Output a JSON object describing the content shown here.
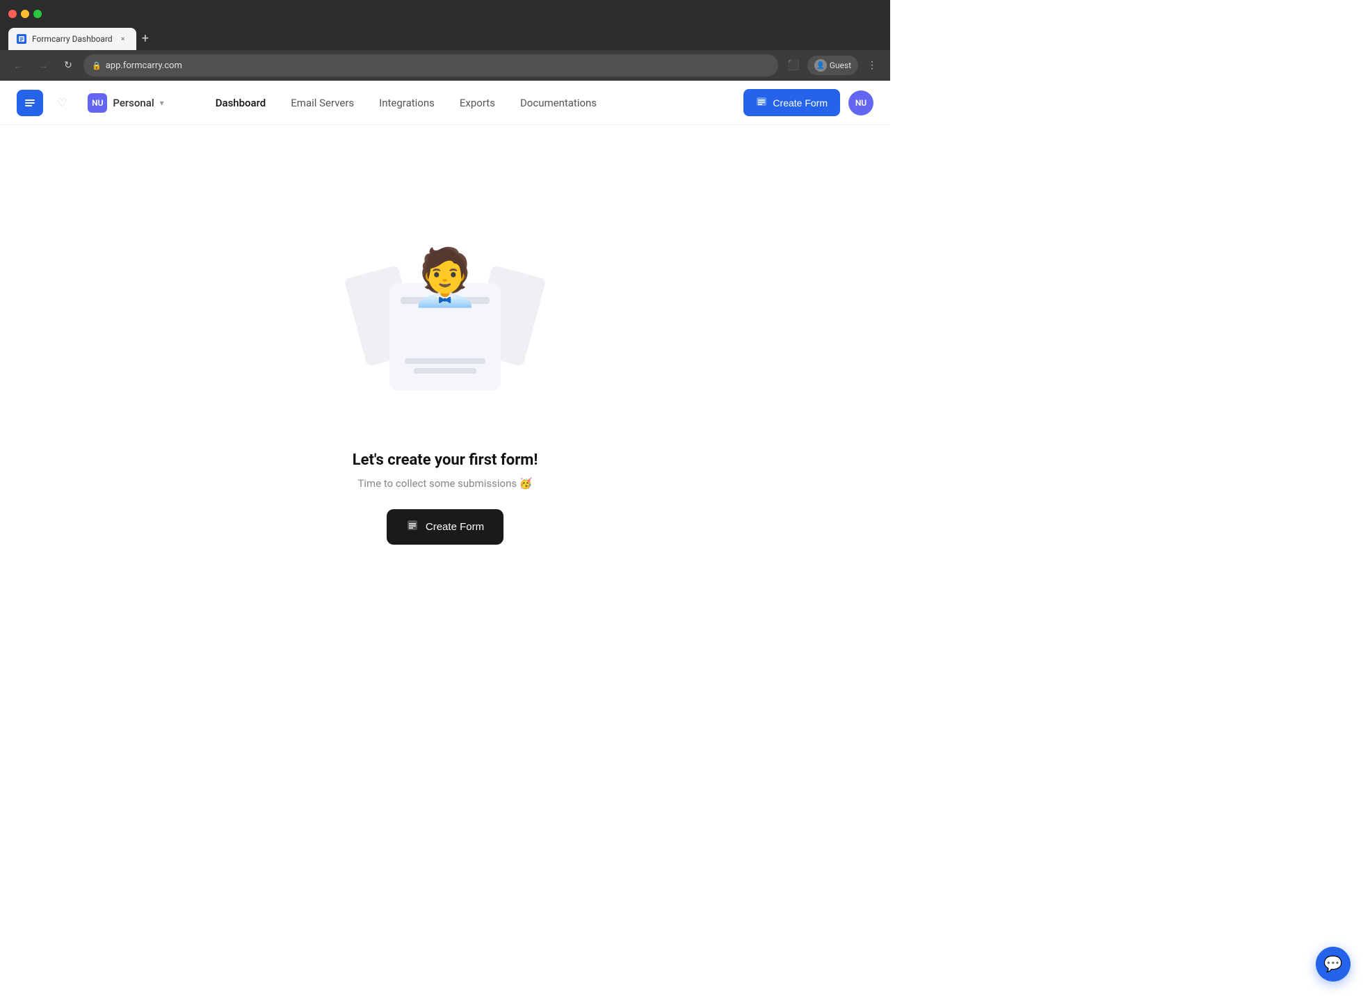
{
  "browser": {
    "tab_title": "Formcarry Dashboard",
    "address": "app.formcarry.com",
    "new_tab_label": "+",
    "tab_close_label": "×",
    "guest_label": "Guest",
    "more_options_label": "⋮"
  },
  "navbar": {
    "logo_icon": "☰",
    "heart_icon": "♡",
    "workspace": {
      "initials": "NU",
      "name": "Personal",
      "chevron": "▾"
    },
    "nav_links": [
      {
        "id": "dashboard",
        "label": "Dashboard",
        "active": true
      },
      {
        "id": "email-servers",
        "label": "Email Servers",
        "active": false
      },
      {
        "id": "integrations",
        "label": "Integrations",
        "active": false
      },
      {
        "id": "exports",
        "label": "Exports",
        "active": false
      },
      {
        "id": "documentations",
        "label": "Documentations",
        "active": false
      }
    ],
    "create_form_label": "Create Form",
    "user_initials": "NU"
  },
  "main": {
    "empty_title": "Let's create your first form!",
    "empty_subtitle": "Time to collect some submissions 🥳",
    "create_form_button": "Create Form"
  },
  "chat": {
    "icon": "💬"
  }
}
